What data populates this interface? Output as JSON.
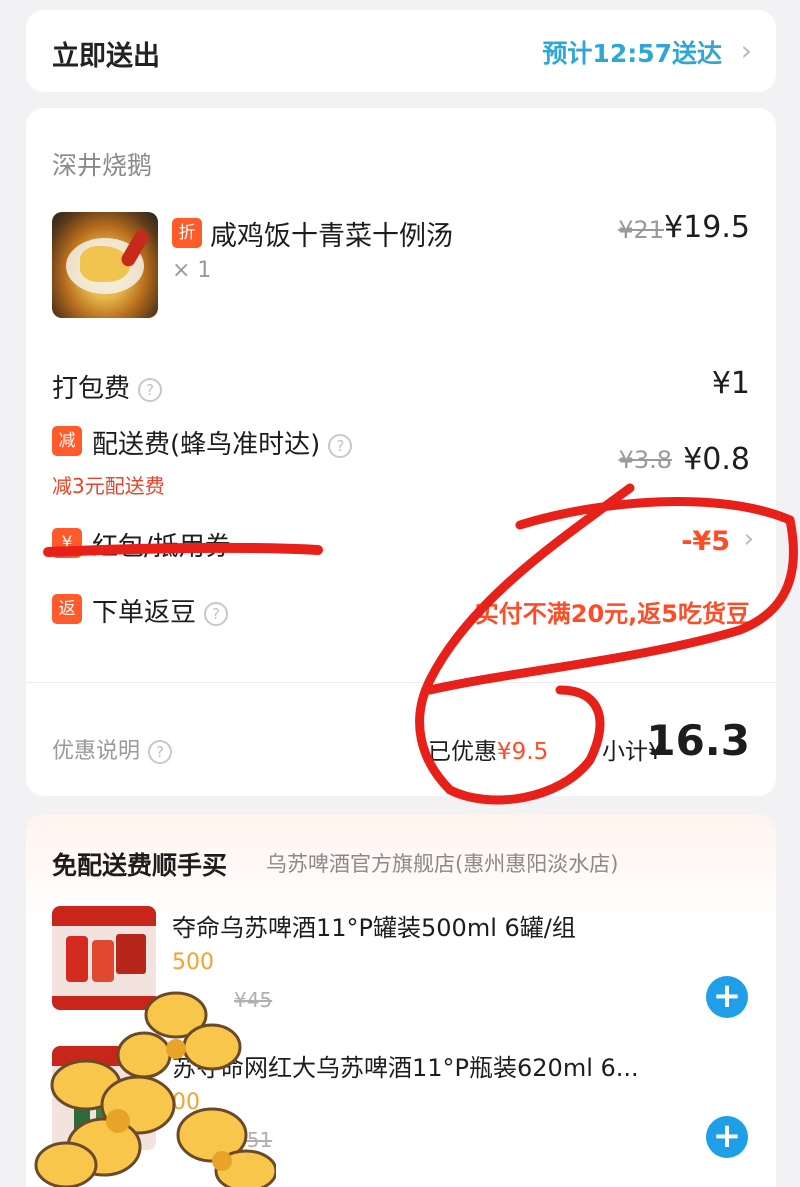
{
  "delivery": {
    "mode": "立即送出",
    "eta": "预计12:57送达",
    "chevron_icon": "chevron-right-icon"
  },
  "order": {
    "shop_name": "深井烧鹅",
    "item": {
      "tag": "折",
      "name": "咸鸡饭十青菜十例汤",
      "qty": "× 1",
      "orig_price": "¥21",
      "price": "¥19.5"
    },
    "packing": {
      "label": "打包费",
      "price": "¥1"
    },
    "delivery_fee": {
      "tag": "减",
      "label": "配送费(蜂鸟准时达)",
      "note": "减3元配送费",
      "orig_price": "¥3.8",
      "price": "¥0.8"
    },
    "coupon": {
      "tag": "¥",
      "label": "红包/抵用券",
      "value": "-¥5"
    },
    "beans": {
      "tag": "返",
      "label": "下单返豆",
      "value": "实付不满20元,返5吃货豆"
    },
    "summary": {
      "promo_label": "优惠说明",
      "saved_label": "已优惠",
      "saved_value": "¥9.5",
      "subtotal_label": "小计¥",
      "subtotal_value": "16.3"
    }
  },
  "addon": {
    "title": "免配送费顺手买",
    "shop": "乌苏啤酒官方旗舰店(惠州惠阳淡水店)",
    "products": [
      {
        "name": "夺命乌苏啤酒11°P罐装500ml 6罐/组",
        "price_line": "500",
        "orig_price": "¥45"
      },
      {
        "name": "苏夺命网红大乌苏啤酒11°P瓶装620ml 6...",
        "price_line": "00",
        "orig_price": "¥51"
      }
    ]
  },
  "colors": {
    "accent_blue": "#2ea7d8",
    "discount_red": "#ff4b26",
    "add_button": "#1e9fe8",
    "annotation_red": "#e8201a"
  }
}
